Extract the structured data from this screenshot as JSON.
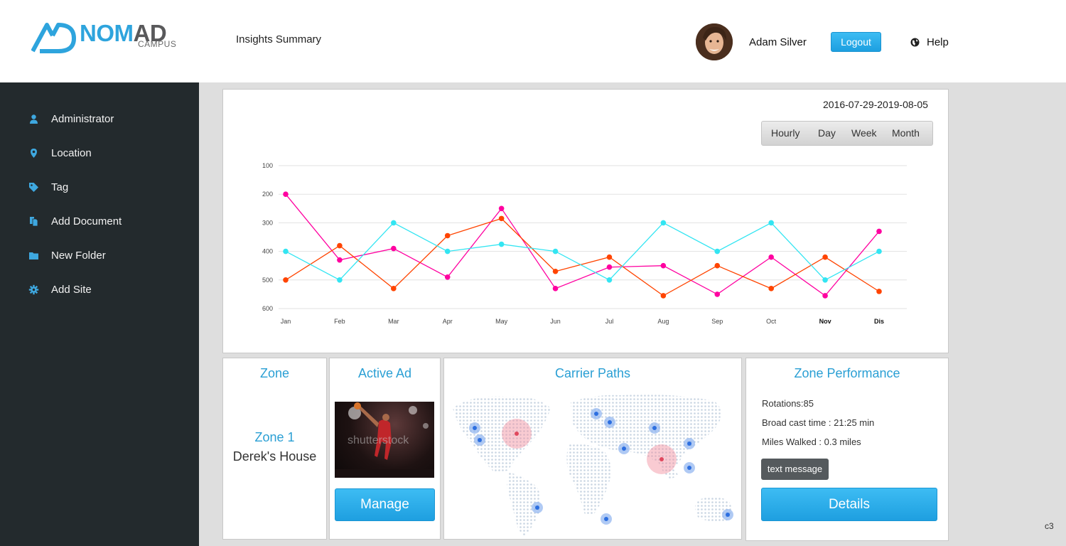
{
  "brand": {
    "name_part1": "NOM",
    "name_part2": "AD",
    "sub": "CAMPUS"
  },
  "header": {
    "page_title": "Insights Summary",
    "user_name": "Adam Silver",
    "logout_label": "Logout",
    "help_label": "Help"
  },
  "sidebar": {
    "items": [
      {
        "label": "Administrator",
        "icon": "user-icon"
      },
      {
        "label": "Location",
        "icon": "map-pin-icon"
      },
      {
        "label": "Tag",
        "icon": "tag-icon"
      },
      {
        "label": "Add Document",
        "icon": "document-icon"
      },
      {
        "label": "New Folder",
        "icon": "folder-icon"
      },
      {
        "label": "Add Site",
        "icon": "gear-icon"
      }
    ]
  },
  "chart_panel": {
    "date_range": "2016-07-29-2019-08-05",
    "ranges": [
      "Hourly",
      "Day",
      "Week",
      "Month"
    ]
  },
  "chart_data": {
    "type": "line",
    "categories": [
      "Jan",
      "Feb",
      "Mar",
      "Apr",
      "May",
      "Jun",
      "Jul",
      "Aug",
      "Sep",
      "Oct",
      "Nov",
      "Dis"
    ],
    "bold_categories": [
      "Nov",
      "Dis"
    ],
    "y_ticks": [
      100,
      200,
      300,
      400,
      500,
      600
    ],
    "ylim": [
      100,
      600
    ],
    "y_inverted": true,
    "grid": true,
    "series": [
      {
        "color": "#ff00a0",
        "values": [
          200,
          430,
          390,
          490,
          250,
          530,
          455,
          450,
          550,
          420,
          555,
          330
        ]
      },
      {
        "color": "#ff4400",
        "values": [
          500,
          380,
          530,
          345,
          285,
          470,
          420,
          555,
          450,
          530,
          420,
          540
        ]
      },
      {
        "color": "#33e5f2",
        "values": [
          400,
          500,
          300,
          400,
          375,
          400,
          500,
          300,
          400,
          300,
          500,
          400
        ]
      }
    ]
  },
  "zone_card": {
    "title": "Zone",
    "zone_name": "Zone 1",
    "place": "Derek's House"
  },
  "ad_card": {
    "title": "Active Ad",
    "image_watermark": "shutterstock",
    "manage_label": "Manage"
  },
  "paths_card": {
    "title": "Carrier Paths"
  },
  "perf_card": {
    "title": "Zone Performance",
    "rotations": "Rotations:85",
    "broadcast": "Broad cast time :  21:25 min",
    "miles": "Miles Walked : 0.3 miles",
    "text_message_label": "text message",
    "details_label": "Details"
  },
  "corner_label": "c3"
}
